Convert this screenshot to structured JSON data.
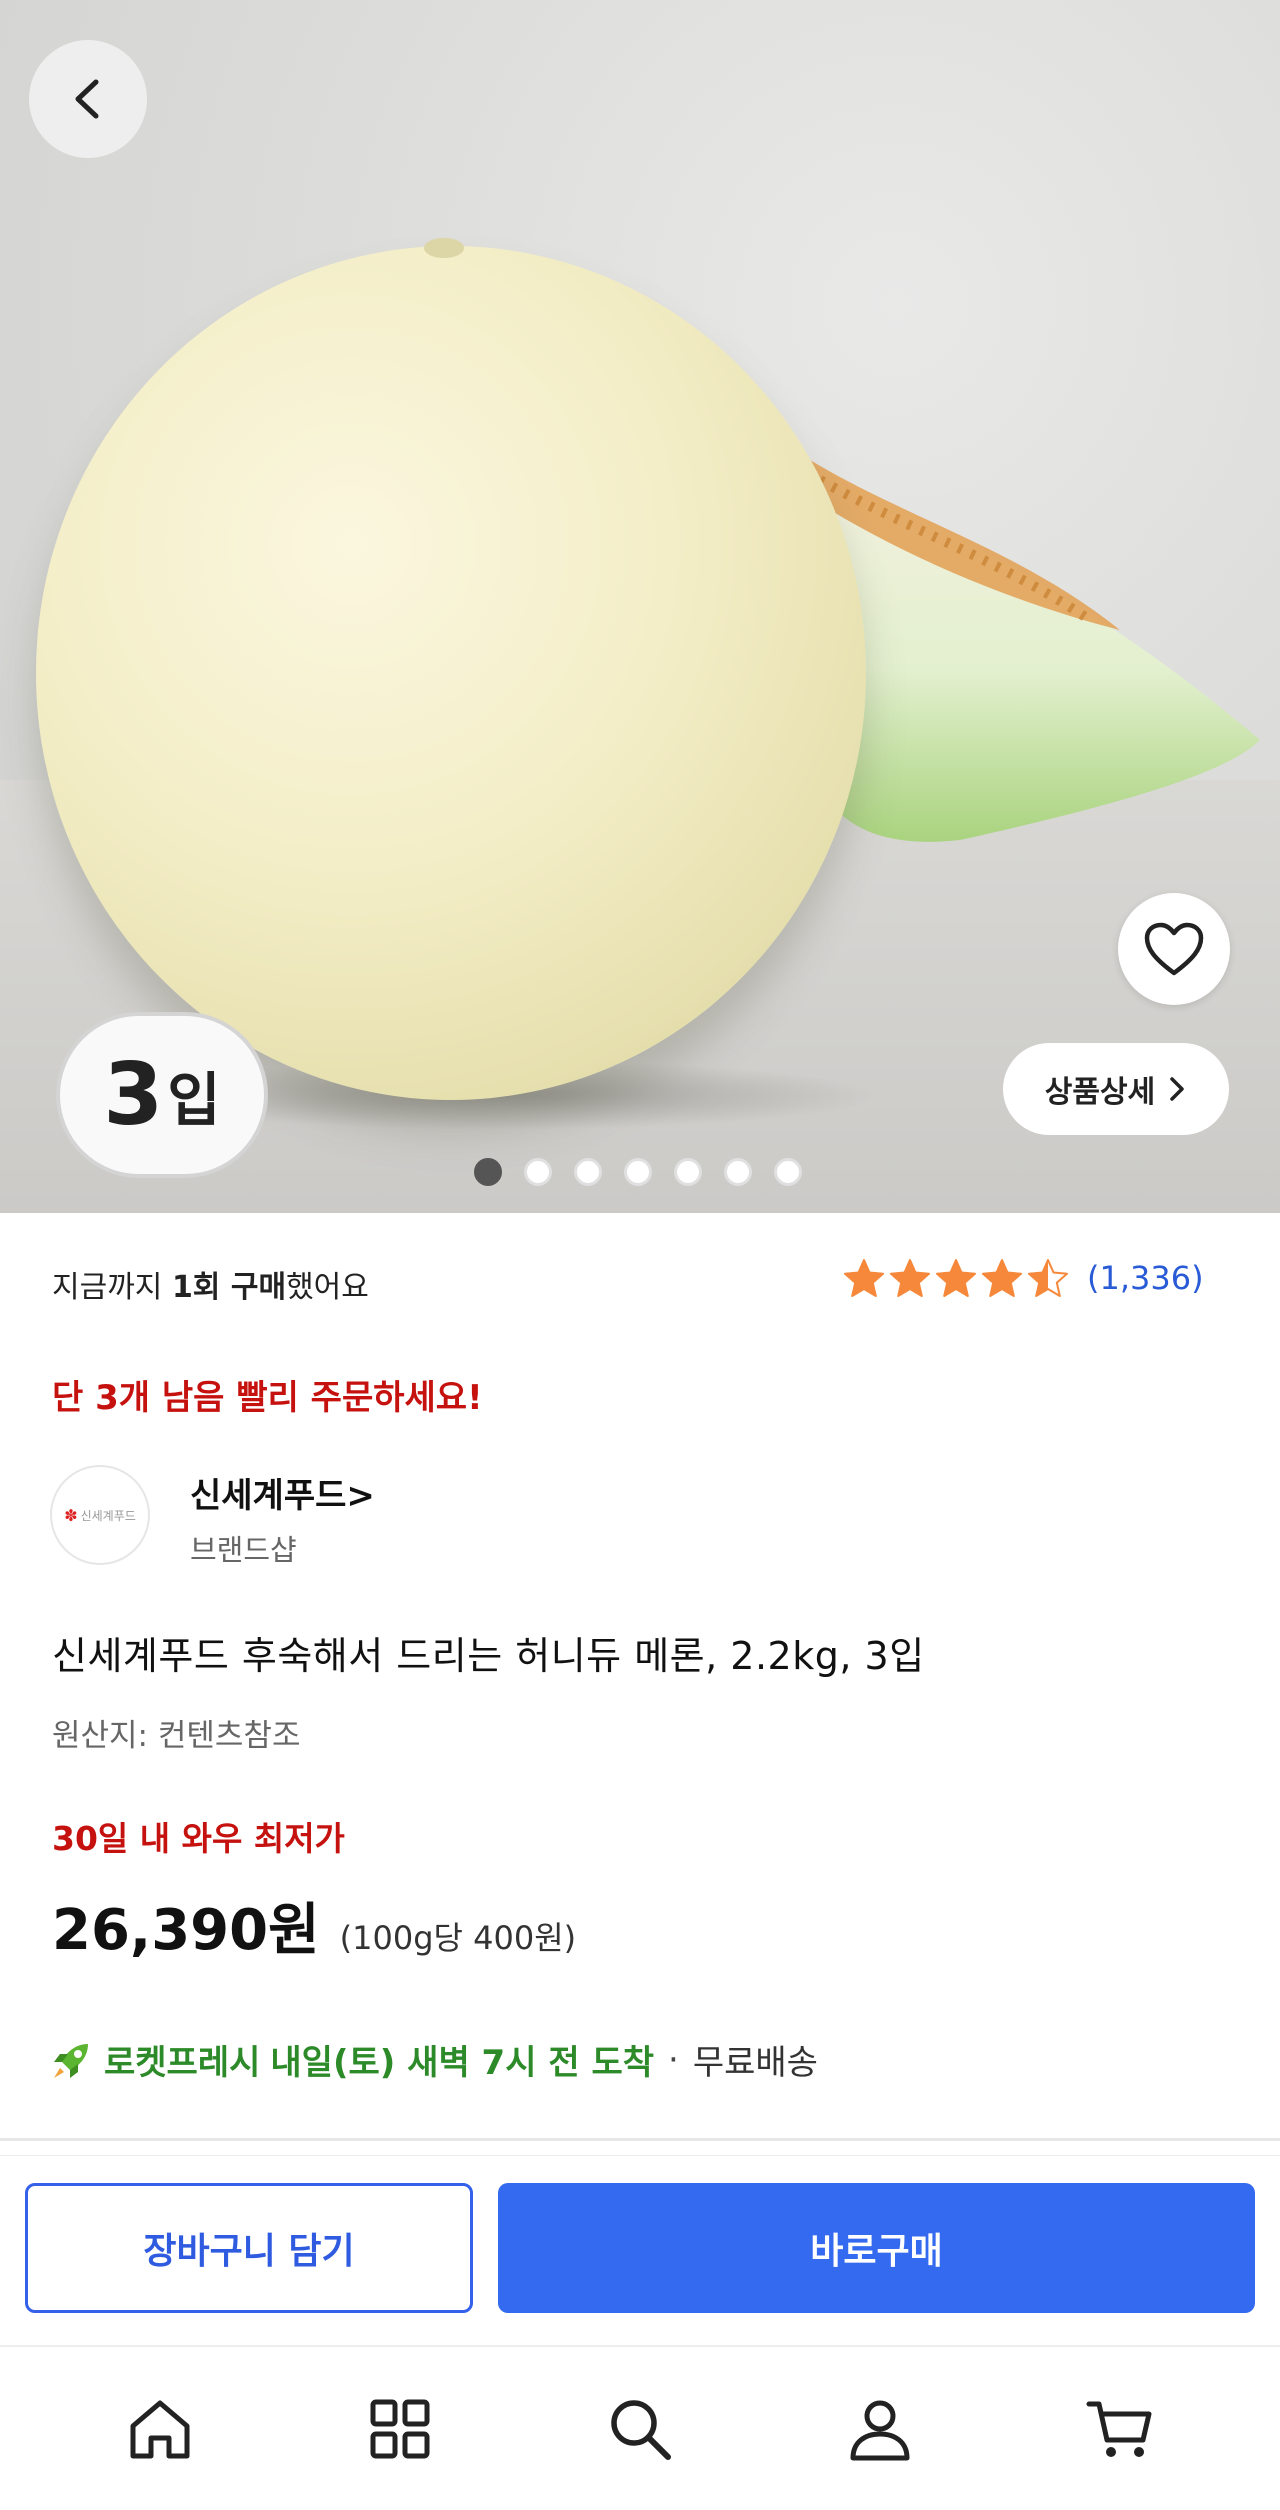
{
  "hero": {
    "badge_number": "3",
    "badge_suffix": "입",
    "detail_button_label": "상품상세",
    "image_count": 7,
    "active_image_index": 0
  },
  "purchase_history": {
    "prefix": "지금까지 ",
    "count": "1회 구매",
    "suffix": "했어요"
  },
  "rating": {
    "stars": 4.5,
    "count_label": "(1,336)",
    "star_color": "#f5883a"
  },
  "stock_notice": "단 3개 남음 빨리 주문하세요!",
  "brand": {
    "name": "신세계푸드>",
    "subtitle": "브랜드샵",
    "logo_text": "신세계푸드"
  },
  "product": {
    "title": "신세계푸드 후숙해서 드리는 허니듀 메론, 2.2kg, 3입",
    "origin": "원산지: 컨텐츠참조"
  },
  "pricing": {
    "lowest_label": "30일 내 와우 최저가",
    "price": "26,390원",
    "unit_price": "(100g당 400원)"
  },
  "delivery": {
    "service": "로켓프레시",
    "eta": "내일(토) 새벽 7시 전 도착",
    "separator": "·",
    "shipping": "무료배송",
    "color": "#2d8a29"
  },
  "actions": {
    "cart_label": "장바구니 담기",
    "buy_label": "바로구매",
    "accent_color": "#346aef"
  },
  "bottom_nav": [
    "home-icon",
    "category-icon",
    "search-icon",
    "profile-icon",
    "cart-icon"
  ]
}
